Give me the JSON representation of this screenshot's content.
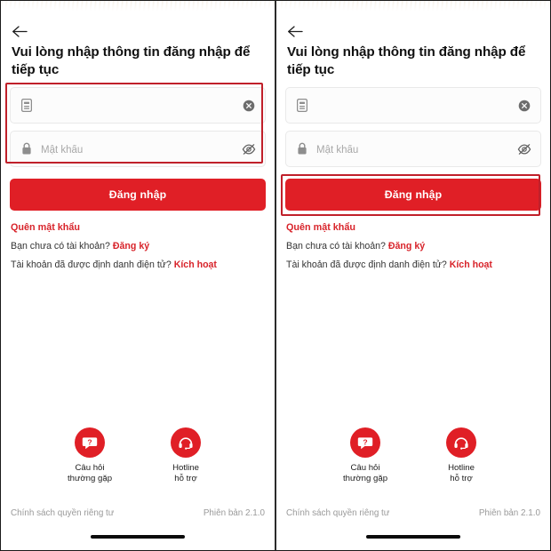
{
  "app": {
    "accent_red": "#e01f26",
    "annotation_red": "#c0202a",
    "heading": "Vui lòng nhập thông tin đăng nhập để tiếp tục"
  },
  "icons": {
    "back": "back-arrow-icon",
    "id_card": "id-card-icon",
    "lock": "lock-icon",
    "clear": "clear-circle-icon",
    "eye_off": "eye-off-icon",
    "faq": "question-bubble-icon",
    "hotline": "headset-support-icon"
  },
  "form": {
    "username": {
      "value": "",
      "placeholder": "",
      "clear_label": "×"
    },
    "password": {
      "value": "",
      "placeholder": "Mật khẩu"
    },
    "submit_label": "Đăng nhập"
  },
  "links": {
    "forgot_password": "Quên mật khẩu",
    "no_account_prefix": "Bạn chưa có tài khoản?",
    "register": "Đăng ký",
    "verified_prefix": "Tài khoản đã được định danh điện tử?",
    "activate": "Kích hoạt"
  },
  "help": [
    {
      "label": "Câu hỏi\nthường gặp",
      "icon": "question-bubble-icon"
    },
    {
      "label": "Hotline\nhỗ trợ",
      "icon": "headset-support-icon"
    }
  ],
  "footer": {
    "privacy": "Chính sách quyền riêng tư",
    "version": "Phiên bản 2.1.0"
  },
  "panels": [
    {
      "id": "left",
      "annotation": "input-fields-highlight"
    },
    {
      "id": "right",
      "annotation": "login-button-highlight"
    }
  ]
}
